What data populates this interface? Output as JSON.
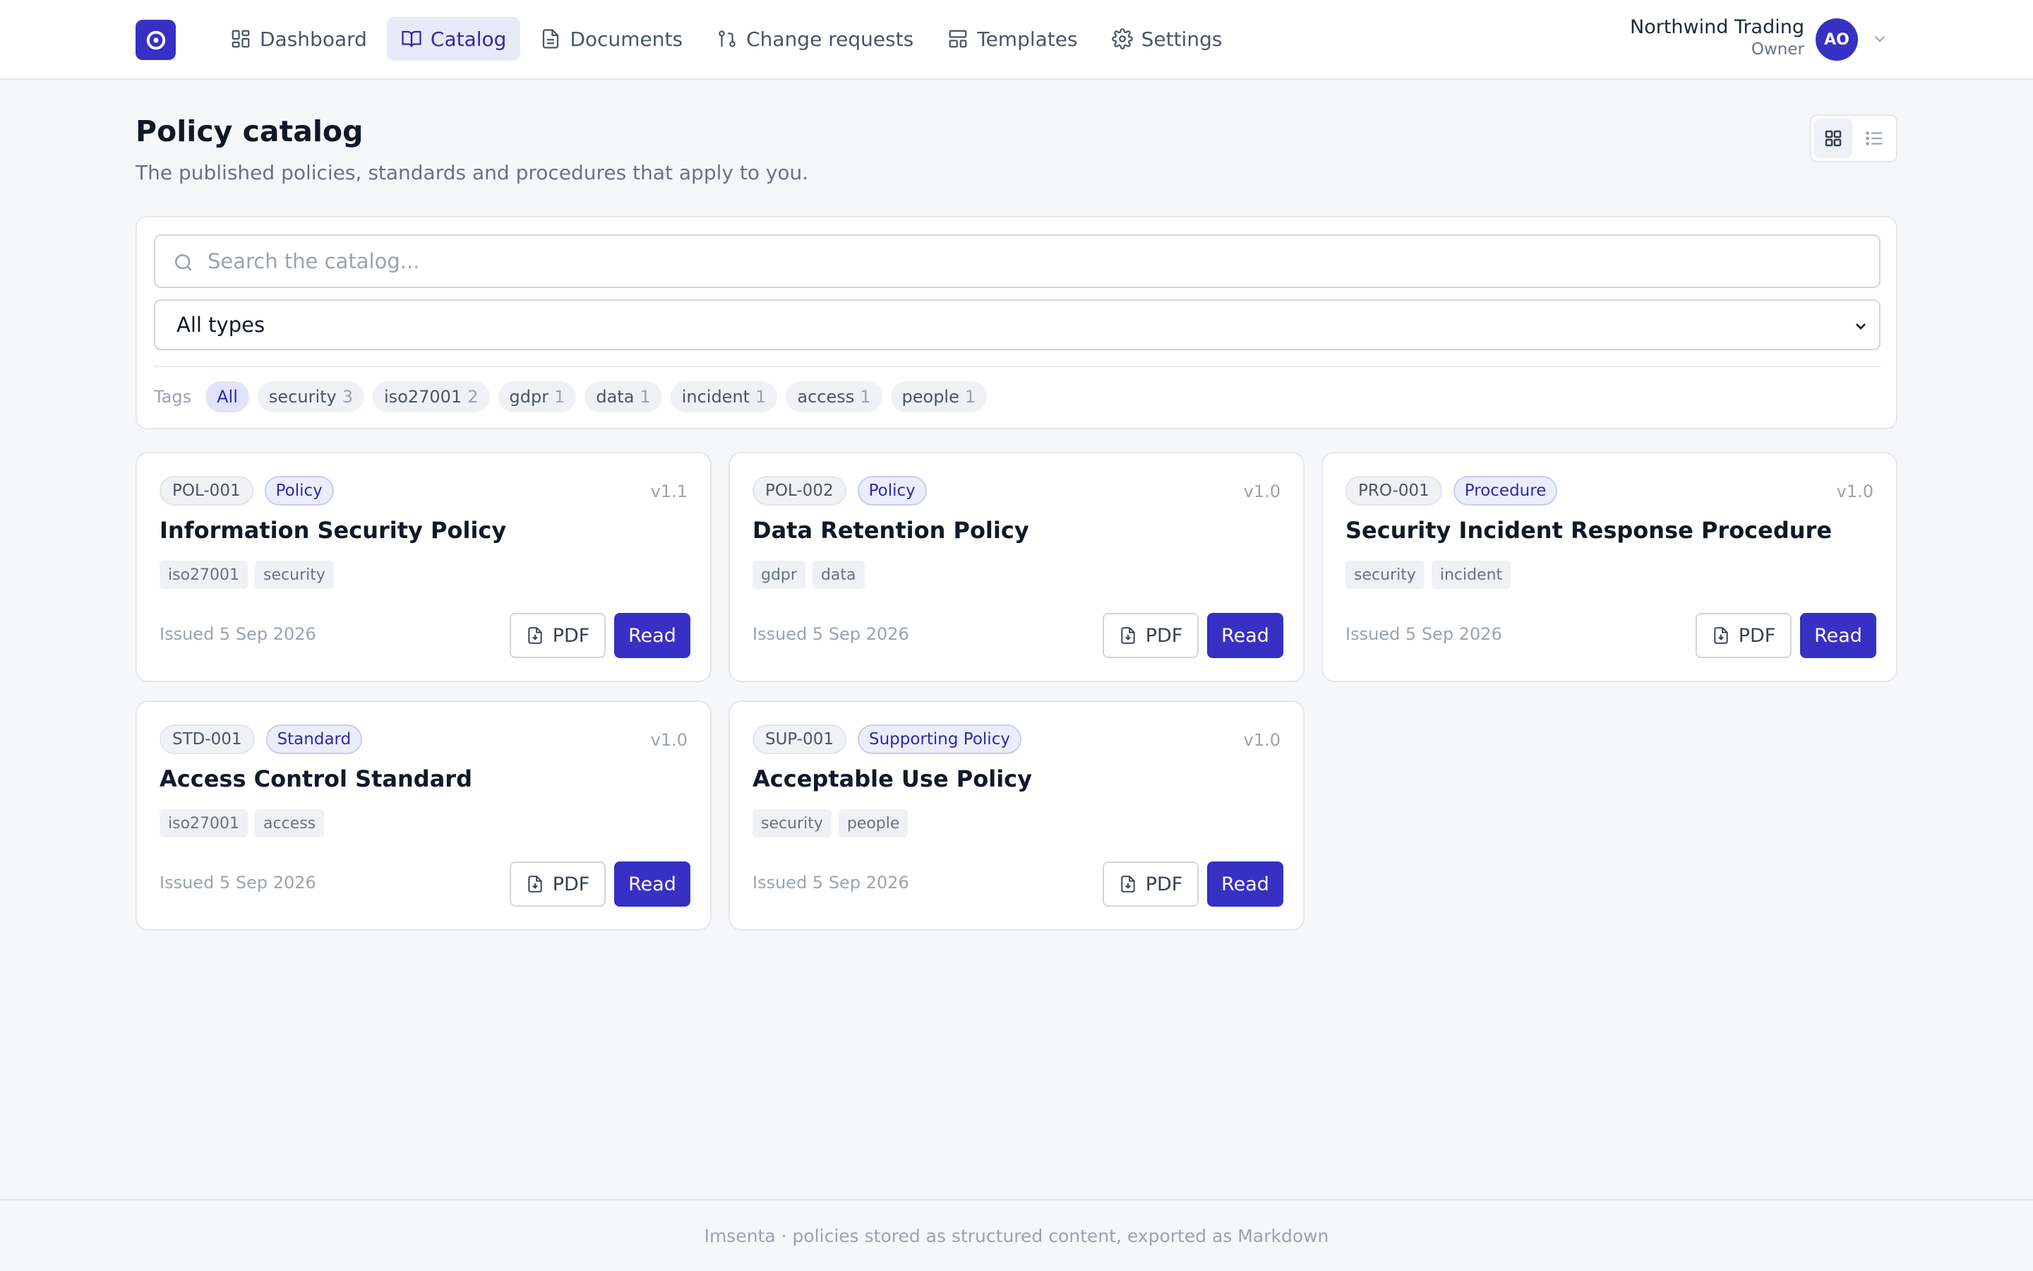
{
  "nav": {
    "items": [
      {
        "label": "Dashboard"
      },
      {
        "label": "Catalog"
      },
      {
        "label": "Documents"
      },
      {
        "label": "Change requests"
      },
      {
        "label": "Templates"
      },
      {
        "label": "Settings"
      }
    ],
    "active": "Catalog"
  },
  "account": {
    "org_name": "Northwind Trading",
    "role": "Owner",
    "initials": "AO"
  },
  "header": {
    "title": "Policy catalog",
    "subtitle": "The published policies, standards and procedures that apply to you.",
    "view_mode": "grid"
  },
  "filters": {
    "search_placeholder": "Search the catalog...",
    "search_value": "",
    "type_selected": "All types",
    "tags_label": "Tags",
    "tags": [
      {
        "label": "All",
        "count": ""
      },
      {
        "label": "security",
        "count": "3"
      },
      {
        "label": "iso27001",
        "count": "2"
      },
      {
        "label": "gdpr",
        "count": "1"
      },
      {
        "label": "data",
        "count": "1"
      },
      {
        "label": "incident",
        "count": "1"
      },
      {
        "label": "access",
        "count": "1"
      },
      {
        "label": "people",
        "count": "1"
      }
    ]
  },
  "cards": [
    {
      "code": "POL-001",
      "type": "Policy",
      "version": "v1.1",
      "title": "Information Security Policy",
      "tags": [
        "iso27001",
        "security"
      ],
      "issued": "Issued 5 Sep 2026",
      "pdf_label": "PDF",
      "read_label": "Read"
    },
    {
      "code": "POL-002",
      "type": "Policy",
      "version": "v1.0",
      "title": "Data Retention Policy",
      "tags": [
        "gdpr",
        "data"
      ],
      "issued": "Issued 5 Sep 2026",
      "pdf_label": "PDF",
      "read_label": "Read"
    },
    {
      "code": "PRO-001",
      "type": "Procedure",
      "version": "v1.0",
      "title": "Security Incident Response Procedure",
      "tags": [
        "security",
        "incident"
      ],
      "issued": "Issued 5 Sep 2026",
      "pdf_label": "PDF",
      "read_label": "Read"
    },
    {
      "code": "STD-001",
      "type": "Standard",
      "version": "v1.0",
      "title": "Access Control Standard",
      "tags": [
        "iso27001",
        "access"
      ],
      "issued": "Issued 5 Sep 2026",
      "pdf_label": "PDF",
      "read_label": "Read"
    },
    {
      "code": "SUP-001",
      "type": "Supporting Policy",
      "version": "v1.0",
      "title": "Acceptable Use Policy",
      "tags": [
        "security",
        "people"
      ],
      "issued": "Issued 5 Sep 2026",
      "pdf_label": "PDF",
      "read_label": "Read"
    }
  ],
  "footer": {
    "text": "Imsenta · policies stored as structured content, exported as Markdown"
  },
  "colors": {
    "brand": "#3730c4",
    "background": "#f6f7f9",
    "nav_active_bg": "#e8eaf8"
  }
}
